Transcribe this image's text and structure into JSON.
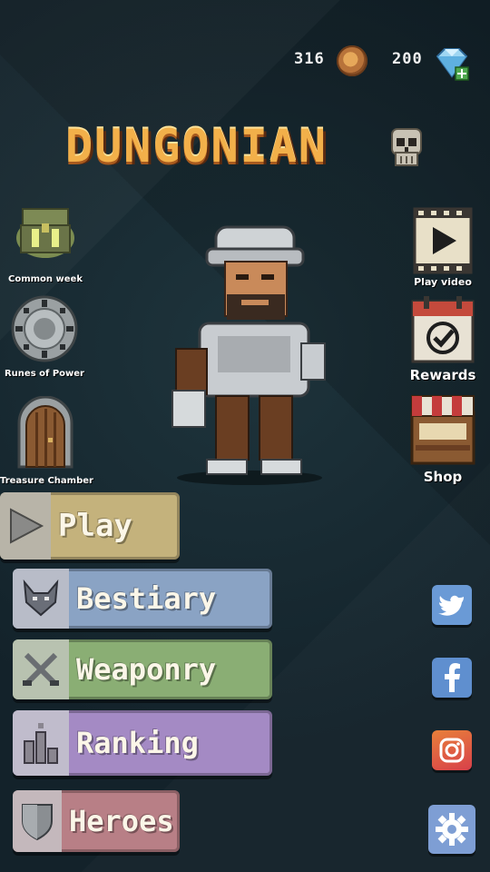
{
  "currency": {
    "coins": "316",
    "gems": "200"
  },
  "title": {
    "text": "DUNGONIAN"
  },
  "left_items": [
    {
      "label": "Common week"
    },
    {
      "label": "Runes of Power"
    },
    {
      "label": "Treasure Chamber"
    }
  ],
  "right_items": [
    {
      "label": "Play video"
    },
    {
      "label": "Rewards"
    },
    {
      "label": "Shop"
    }
  ],
  "menu": {
    "play": "Play",
    "bestiary": "Bestiary",
    "weaponry": "Weaponry",
    "ranking": "Ranking",
    "heroes": "Heroes"
  },
  "colors": {
    "play": "#c4b27c",
    "bestiary": "#8aa3c4",
    "weaponry": "#8aae74",
    "ranking": "#a48ac4",
    "heroes": "#b87f86",
    "twitter": "#6a9ad6",
    "facebook": "#5f8fcf",
    "instagram": "#e05a3a",
    "settings": "#7e9ed4"
  },
  "icons": {
    "coin": "wood-coin-icon",
    "gem": "diamond-plus-icon",
    "skull": "skull-icon",
    "chest": "treasure-chest-icon",
    "runes": "rune-circle-icon",
    "door": "dungeon-door-icon",
    "video": "film-play-icon",
    "calendar": "calendar-check-icon",
    "shop": "market-stall-icon",
    "play": "play-triangle-icon",
    "bestiary": "wolf-head-icon",
    "weaponry": "crossed-swords-icon",
    "ranking": "podium-icon",
    "heroes": "shield-icon",
    "twitter": "twitter-icon",
    "facebook": "facebook-icon",
    "instagram": "instagram-icon",
    "settings": "gear-icon"
  }
}
